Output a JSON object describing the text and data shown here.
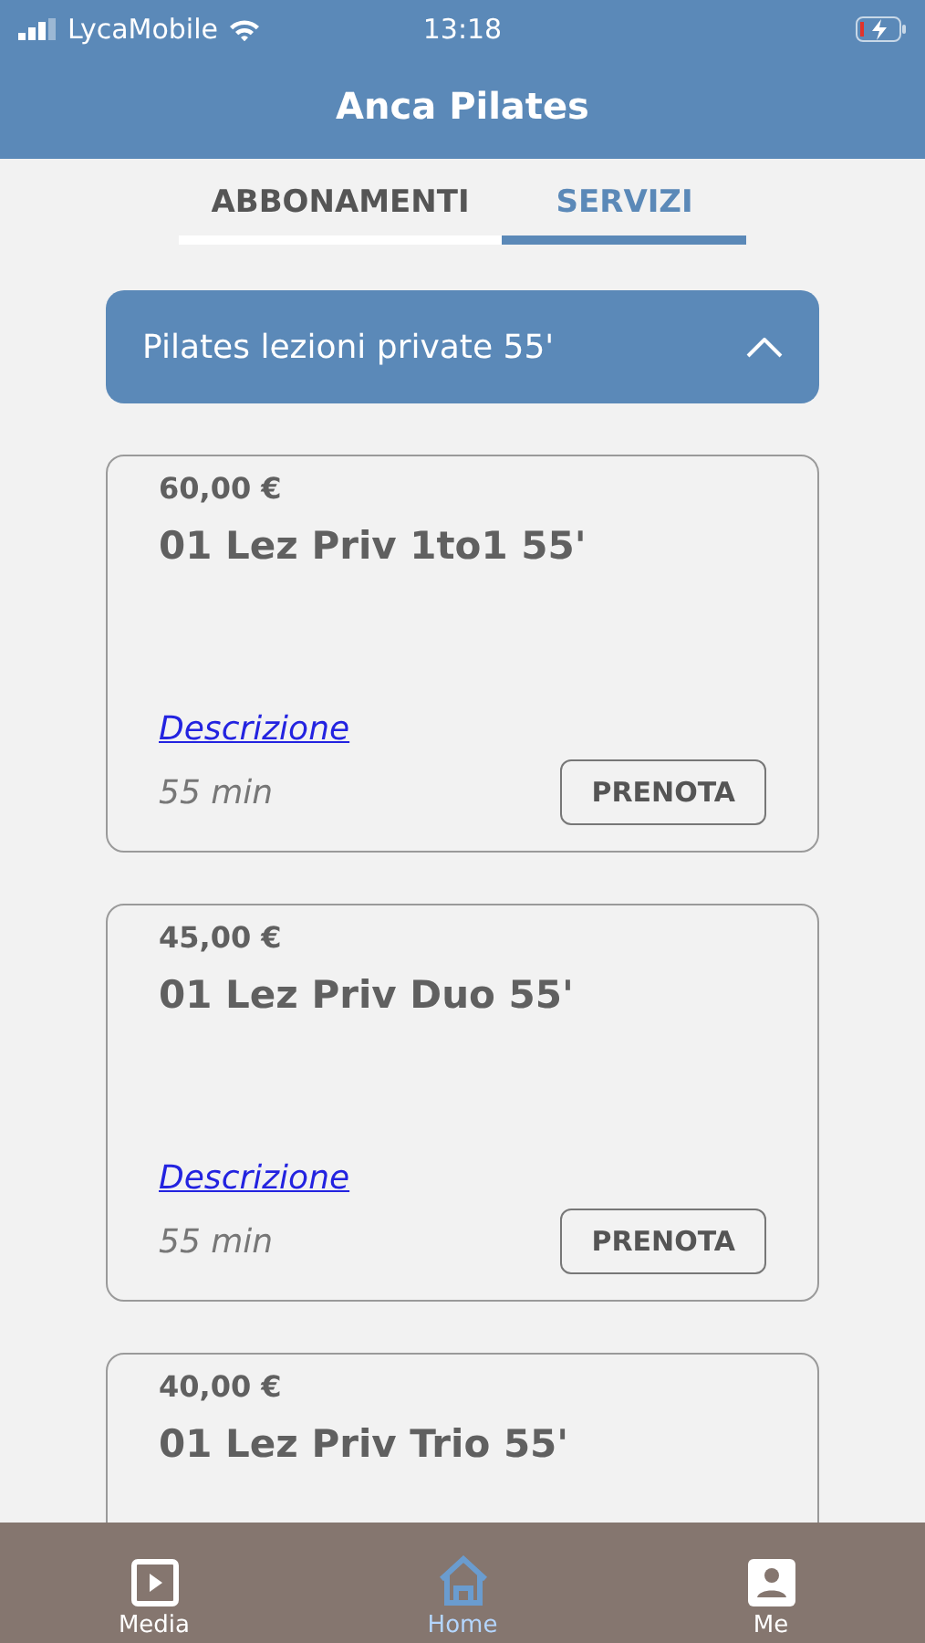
{
  "status_bar": {
    "carrier": "LycaMobile",
    "time": "13:18"
  },
  "header": {
    "title": "Anca Pilates"
  },
  "tabs": [
    {
      "label": "ABBONAMENTI",
      "selected": false
    },
    {
      "label": "SERVIZI",
      "selected": true
    }
  ],
  "category": {
    "title": "Pilates lezioni private 55'",
    "expanded": true
  },
  "services": [
    {
      "price": "60,00 €",
      "name": "01 Lez Priv 1to1 55'",
      "link": "Descrizione",
      "duration": "55 min",
      "button": "PRENOTA"
    },
    {
      "price": "45,00 €",
      "name": "01 Lez Priv Duo 55'",
      "link": "Descrizione",
      "duration": "55 min",
      "button": "PRENOTA"
    },
    {
      "price": "40,00 €",
      "name": "01 Lez Priv Trio 55'"
    }
  ],
  "bottom_nav": [
    {
      "label": "Media",
      "selected": false
    },
    {
      "label": "Home",
      "selected": true
    },
    {
      "label": "Me",
      "selected": false
    }
  ]
}
